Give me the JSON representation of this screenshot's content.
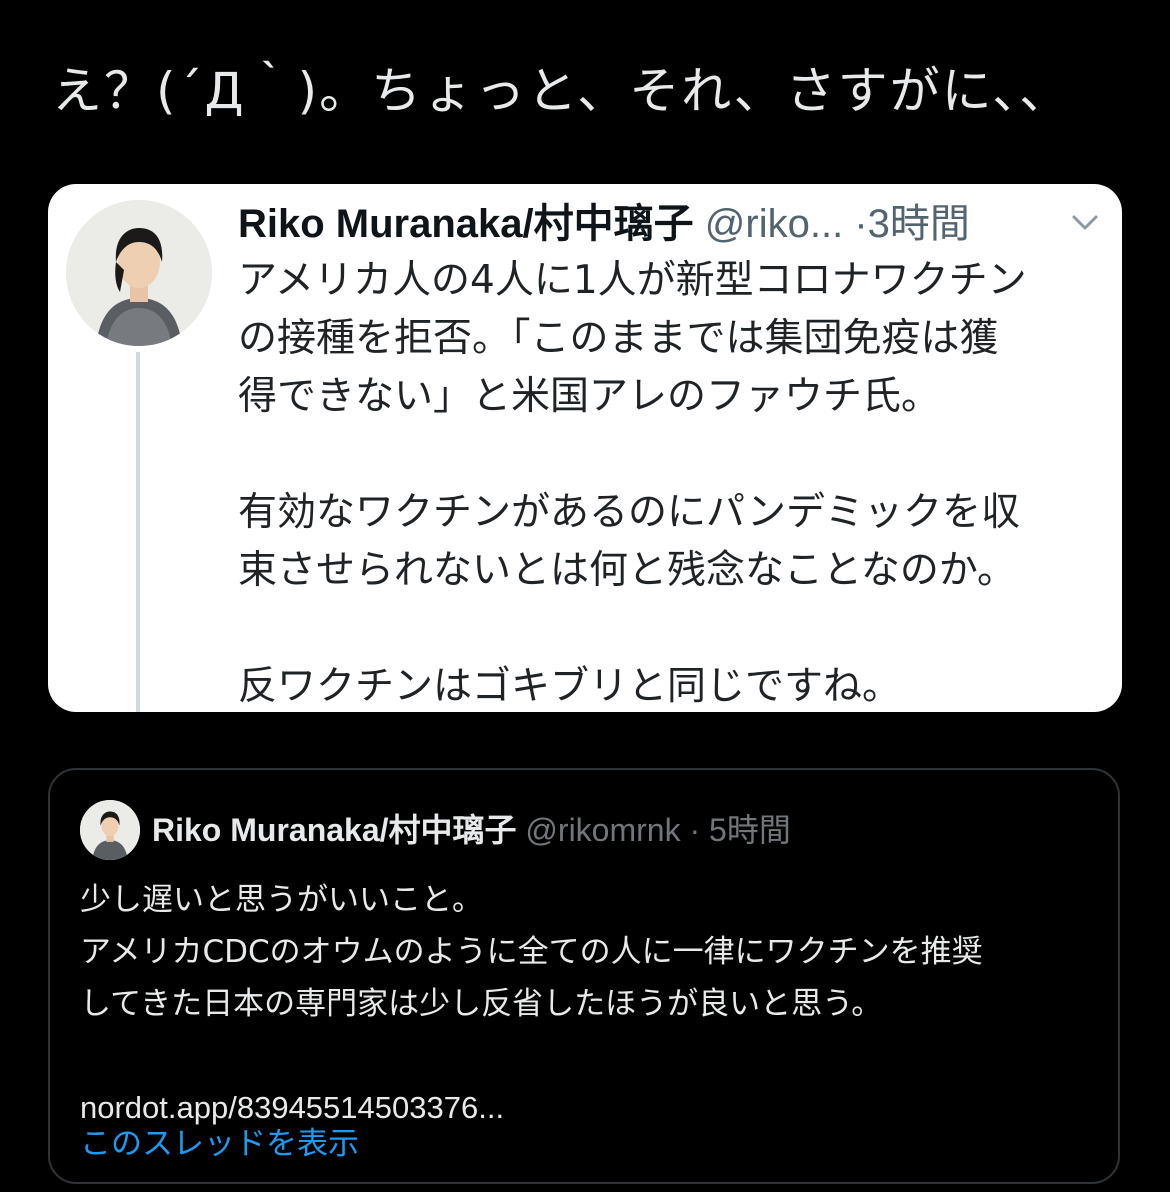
{
  "tweet": {
    "text": "え？(´Д｀)。ちょっと、それ、さすがに、、"
  },
  "image_tweet": {
    "name": "Riko Muranaka/村中璃子",
    "handle": "@riko...",
    "dot": "·",
    "time": "3時間",
    "lines": [
      "アメリカ人の4人に1人が新型コロナワクチン",
      "の接種を拒否。「このままでは集団免疫は獲",
      "得できない」と米国アレのファウチ氏。",
      "",
      "有効なワクチンがあるのにパンデミックを収",
      "束させられないとは何と残念なことなのか。",
      "",
      "反ワクチンはゴキブリと同じですね。"
    ]
  },
  "quote_tweet": {
    "name": "Riko Muranaka/村中璃子",
    "handle": "@rikomrnk",
    "dot": "·",
    "time": "5時間",
    "lines": [
      "少し遅いと思うがいいこと。",
      "アメリカCDCのオウムのように全ての人に一律にワクチンを推奨",
      "してきた日本の専門家は少し反省したほうが良いと思う。",
      "",
      "nordot.app/83945514503376..."
    ],
    "show_thread": "このスレッドを表示"
  },
  "colors": {
    "background": "#000000",
    "card_white": "#ffffff",
    "link_blue": "#1d9bf0",
    "muted_gray": "#71767b"
  },
  "icons": {
    "chevron": "chevron-down-icon"
  }
}
